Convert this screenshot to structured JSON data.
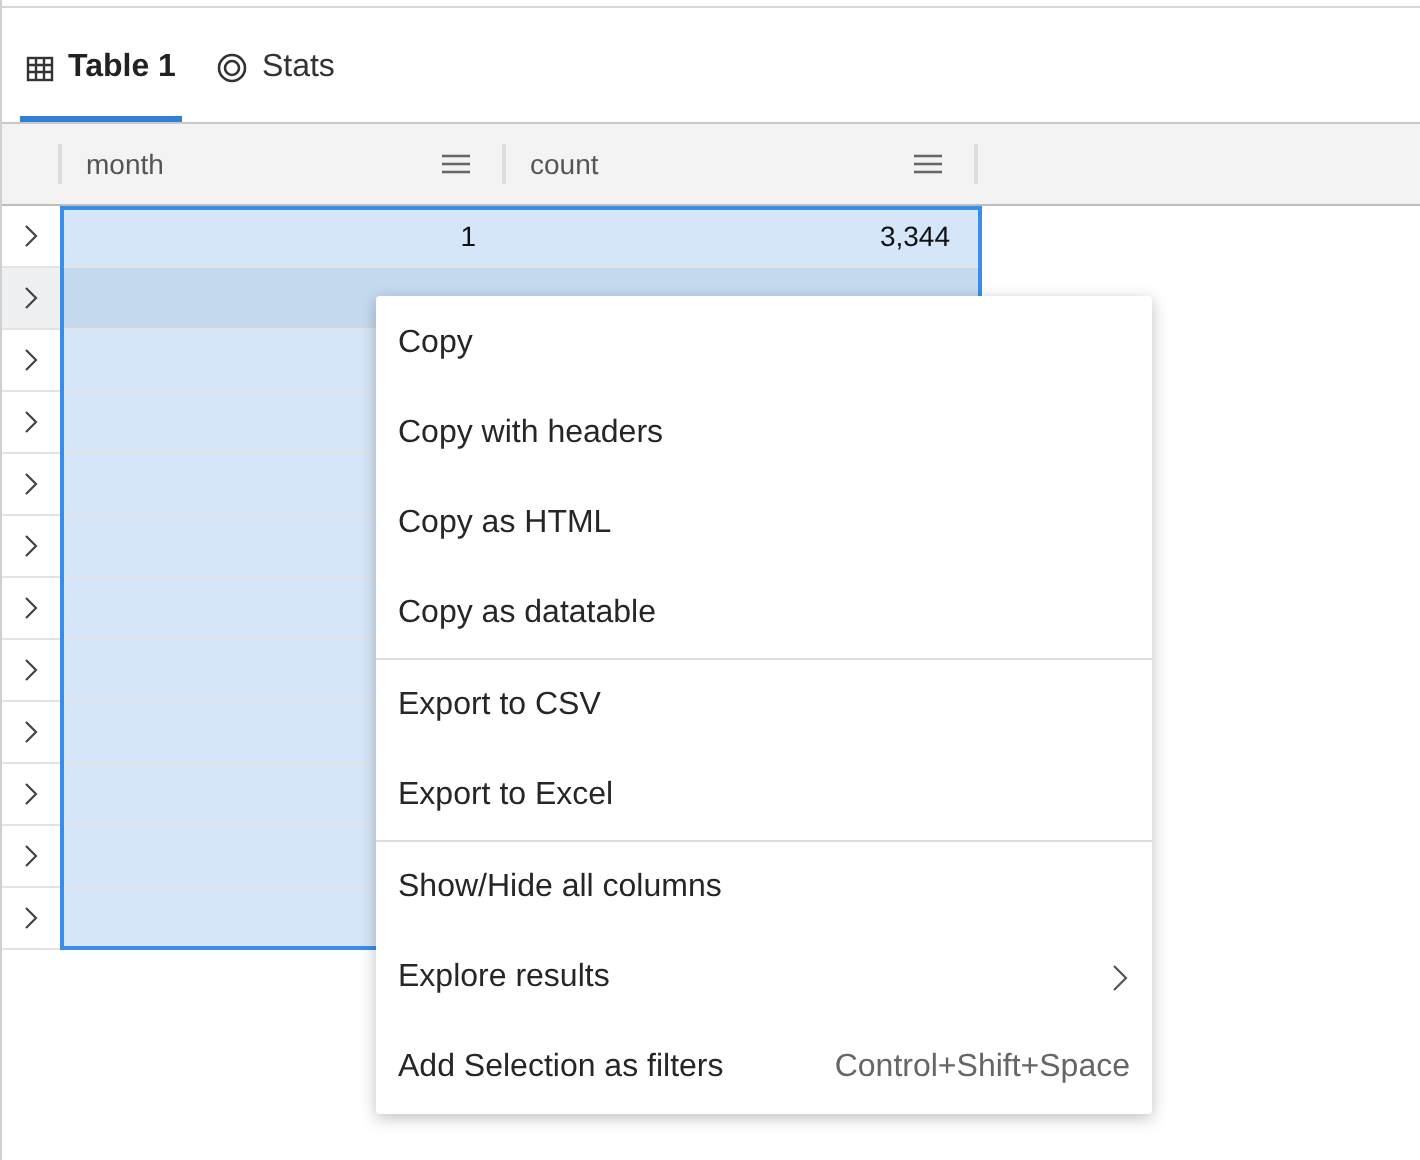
{
  "tabs": [
    {
      "label": "Table 1",
      "kind": "table",
      "selected": true
    },
    {
      "label": "Stats",
      "kind": "stats",
      "selected": false
    }
  ],
  "table": {
    "columns": [
      "month",
      "count"
    ],
    "rows": [
      {
        "cells": [
          "1",
          "3,344"
        ],
        "highlighted": false
      },
      {
        "highlighted": true
      },
      {
        "highlighted": false
      },
      {
        "highlighted": false
      },
      {
        "highlighted": false
      },
      {
        "highlighted": false
      },
      {
        "highlighted": false
      },
      {
        "highlighted": false
      },
      {
        "highlighted": false
      },
      {
        "highlighted": false
      },
      {
        "highlighted": false
      },
      {
        "highlighted": false
      }
    ]
  },
  "context_menu": {
    "groups": [
      [
        {
          "label": "Copy"
        },
        {
          "label": "Copy with headers"
        },
        {
          "label": "Copy as HTML"
        },
        {
          "label": "Copy as datatable"
        }
      ],
      [
        {
          "label": "Export to CSV"
        },
        {
          "label": "Export to Excel"
        }
      ],
      [
        {
          "label": "Show/Hide all columns"
        },
        {
          "label": "Explore results",
          "submenu": true
        },
        {
          "label": "Add Selection as filters",
          "shortcut": "Control+Shift+Space"
        }
      ]
    ]
  }
}
